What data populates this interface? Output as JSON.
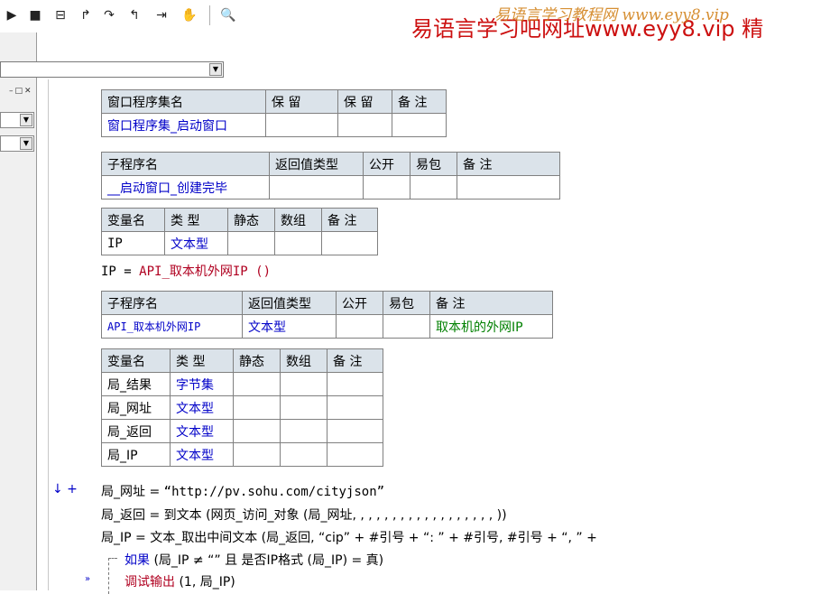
{
  "toolbar": {
    "icons": [
      "play-icon",
      "stop-icon",
      "step-icon",
      "step-into-icon",
      "step-over-icon",
      "step-out-icon",
      "run-to-icon",
      "hand-icon",
      "search-icon"
    ]
  },
  "watermark": {
    "main": "易语言学习吧网址www.eyy8.vip 精",
    "overlay": "易语言学习教程网 www.eyy8.vip"
  },
  "tables": {
    "assembly": {
      "headers": [
        "窗口程序集名",
        "保 留",
        "保 留",
        "备 注"
      ],
      "row": [
        "窗口程序集_启动窗口",
        "",
        "",
        ""
      ]
    },
    "sub1": {
      "headers": [
        "子程序名",
        "返回值类型",
        "公开",
        "易包",
        "备 注"
      ],
      "row": [
        "__启动窗口_创建完毕",
        "",
        "",
        "",
        ""
      ]
    },
    "vars1": {
      "headers": [
        "变量名",
        "类 型",
        "静态",
        "数组",
        "备 注"
      ],
      "rows": [
        [
          "IP",
          "文本型",
          "",
          "",
          ""
        ]
      ]
    },
    "sub2": {
      "headers": [
        "子程序名",
        "返回值类型",
        "公开",
        "易包",
        "备 注"
      ],
      "row": [
        "API_取本机外网IP",
        "文本型",
        "",
        "",
        "取本机的外网IP"
      ]
    },
    "vars2": {
      "headers": [
        "变量名",
        "类 型",
        "静态",
        "数组",
        "备 注"
      ],
      "rows": [
        [
          "局_结果",
          "字节集",
          "",
          "",
          ""
        ],
        [
          "局_网址",
          "文本型",
          "",
          "",
          ""
        ],
        [
          "局_返回",
          "文本型",
          "",
          "",
          ""
        ],
        [
          "局_IP",
          "文本型",
          "",
          "",
          ""
        ]
      ]
    }
  },
  "code": {
    "line1": {
      "var": "IP",
      "op": " = ",
      "call": "API_取本机外网IP ()"
    },
    "line2": {
      "marker": "↓ +",
      "var": "局_网址",
      "op": " = ",
      "value": "“http://pv.sohu.com/cityjson”"
    },
    "line3": {
      "text": "局_返回 = 到文本 (网页_访问_对象 (局_网址, , , , , , , , , , , , , , , , , , ))"
    },
    "line4": {
      "text": "局_IP = 文本_取出中间文本 (局_返回, “cip” + #引号 + “: ” + #引号, #引号 + “, ” +"
    },
    "line5": {
      "keyword": "如果",
      "text": " (局_IP ≠ “” 且 是否IP格式 (局_IP) = 真)"
    },
    "line6": {
      "marker": "»",
      "keyword": "调试输出",
      "text": " (1, 局_IP)"
    }
  }
}
